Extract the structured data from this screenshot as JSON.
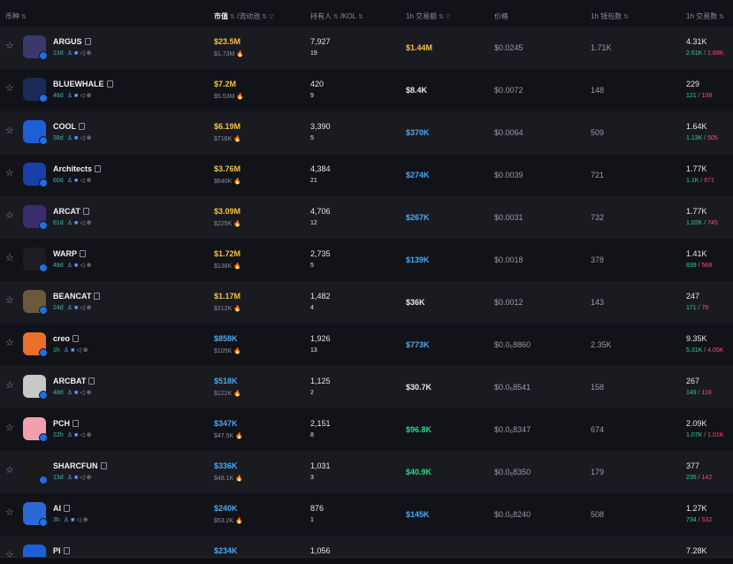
{
  "header": {
    "token": "币种",
    "mcap": "市值",
    "liquidity": "/流动池",
    "holders": "持有人",
    "kol": "/KOL",
    "volume": "1h 交易额",
    "price": "价格",
    "wallets": "1h 钱包数",
    "txns": "1h 交易数"
  },
  "rows": [
    {
      "symbol": "ARGUS",
      "age": "13d",
      "mcap": "$23.5M",
      "mcap_color": "y",
      "liq": "$1.73M",
      "holders": "7,927",
      "kol": "19",
      "volume": "$1.44M",
      "vol_color": "y",
      "price": "$0.0245",
      "wallets": "1.71K",
      "txns": "4.31K",
      "buys": "2.61K",
      "sells": "1.69K"
    },
    {
      "symbol": "BLUEWHALE",
      "age": "48d",
      "mcap": "$7.2M",
      "mcap_color": "y",
      "liq": "$5.53M",
      "holders": "420",
      "kol": "9",
      "volume": "$8.4K",
      "vol_color": "w",
      "price": "$0.0072",
      "wallets": "148",
      "txns": "229",
      "buys": "121",
      "sells": "108"
    },
    {
      "symbol": "COOL",
      "age": "38d",
      "mcap": "$6.19M",
      "mcap_color": "y",
      "liq": "$716K",
      "holders": "3,390",
      "kol": "5",
      "volume": "$370K",
      "vol_color": "bl",
      "price": "$0.0064",
      "wallets": "509",
      "txns": "1.64K",
      "buys": "1.13K",
      "sells": "505"
    },
    {
      "symbol": "Architects",
      "age": "60d",
      "mcap": "$3.76M",
      "mcap_color": "y",
      "liq": "$640K",
      "holders": "4,384",
      "kol": "21",
      "volume": "$274K",
      "vol_color": "bl",
      "price": "$0.0039",
      "wallets": "721",
      "txns": "1.77K",
      "buys": "1.1K",
      "sells": "671"
    },
    {
      "symbol": "ARCAT",
      "age": "61d",
      "mcap": "$3.09M",
      "mcap_color": "y",
      "liq": "$225K",
      "holders": "4,706",
      "kol": "12",
      "volume": "$267K",
      "vol_color": "bl",
      "price": "$0.0031",
      "wallets": "732",
      "txns": "1.77K",
      "buys": "1.02K",
      "sells": "745"
    },
    {
      "symbol": "WARP",
      "age": "48d",
      "mcap": "$1.72M",
      "mcap_color": "y",
      "liq": "$138K",
      "holders": "2,735",
      "kol": "5",
      "volume": "$139K",
      "vol_color": "bl",
      "price": "$0.0018",
      "wallets": "378",
      "txns": "1.41K",
      "buys": "839",
      "sells": "568"
    },
    {
      "symbol": "BEANCAT",
      "age": "24d",
      "mcap": "$1.17M",
      "mcap_color": "y",
      "liq": "$212K",
      "holders": "1,482",
      "kol": "4",
      "volume": "$36K",
      "vol_color": "w",
      "price": "$0.0012",
      "wallets": "143",
      "txns": "247",
      "buys": "171",
      "sells": "76"
    },
    {
      "symbol": "creo",
      "age": "1h",
      "mcap": "$858K",
      "mcap_color": "bl",
      "liq": "$105K",
      "holders": "1,926",
      "kol": "13",
      "volume": "$773K",
      "vol_color": "bl",
      "price": "$0.0₆8860",
      "wallets": "2.35K",
      "txns": "9.35K",
      "buys": "5.31K",
      "sells": "4.05K"
    },
    {
      "symbol": "ARCBAT",
      "age": "48d",
      "mcap": "$518K",
      "mcap_color": "bl",
      "liq": "$122K",
      "holders": "1,125",
      "kol": "2",
      "volume": "$30.7K",
      "vol_color": "w",
      "price": "$0.0₆8541",
      "wallets": "158",
      "txns": "267",
      "buys": "149",
      "sells": "118"
    },
    {
      "symbol": "PCH",
      "age": "22h",
      "mcap": "$347K",
      "mcap_color": "bl",
      "liq": "$47.5K",
      "holders": "2,151",
      "kol": "8",
      "volume": "$96.8K",
      "vol_color": "g",
      "price": "$0.0₆8347",
      "wallets": "674",
      "txns": "2.09K",
      "buys": "1.07K",
      "sells": "1.01K"
    },
    {
      "symbol": "SHARCFUN",
      "age": "13d",
      "mcap": "$336K",
      "mcap_color": "bl",
      "liq": "$48.1K",
      "holders": "1,031",
      "kol": "3",
      "volume": "$40.9K",
      "vol_color": "g",
      "price": "$0.0₆8350",
      "wallets": "179",
      "txns": "377",
      "buys": "235",
      "sells": "142"
    },
    {
      "symbol": "AI",
      "age": "3h",
      "mcap": "$240K",
      "mcap_color": "bl",
      "liq": "$53.2K",
      "holders": "876",
      "kol": "1",
      "volume": "$145K",
      "vol_color": "bl",
      "price": "$0.0₆8240",
      "wallets": "508",
      "txns": "1.27K",
      "buys": "734",
      "sells": "532"
    },
    {
      "symbol": "PI",
      "age": "",
      "mcap": "$234K",
      "mcap_color": "bl",
      "liq": "",
      "holders": "1,056",
      "kol": "",
      "volume": "",
      "vol_color": "w",
      "price": "",
      "wallets": "",
      "txns": "7.28K",
      "buys": "",
      "sells": ""
    }
  ],
  "avatars": [
    "#3a3a6a",
    "#1b2a5a",
    "#1f5fd6",
    "#1a3fa8",
    "#3a2d6e",
    "#1e1e22",
    "#6b5a3a",
    "#e8702a",
    "#c8c8c8",
    "#f2a0b0",
    "#1a1a1a",
    "#2a6ad6",
    "#1f5fd6"
  ]
}
